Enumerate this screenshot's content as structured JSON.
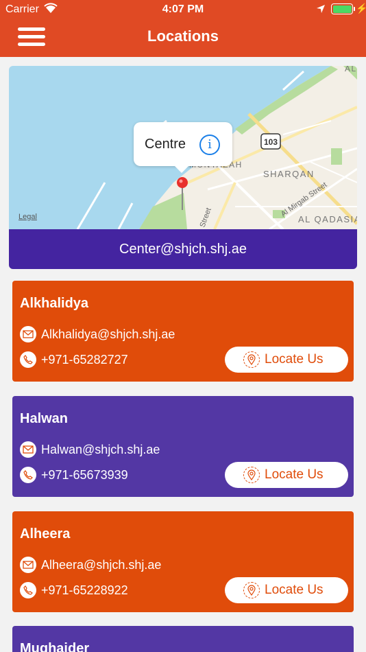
{
  "status_bar": {
    "carrier": "Carrier",
    "time": "4:07 PM"
  },
  "header": {
    "title": "Locations"
  },
  "map": {
    "callout_name": "Centre",
    "legal_label": "Legal",
    "labels": {
      "district_partial": "MUNTAZAH",
      "district2": "SHARQAN",
      "district3": "AL QADASIA",
      "street1": "Al Mirgab Street",
      "street2": "Street",
      "road_badge": "103",
      "corner": "AL"
    },
    "email": "Center@shjch.shj.ae"
  },
  "locations": [
    {
      "name": "Alkhalidya",
      "email": "Alkhalidya@shjch.shj.ae",
      "phone": "+971-65282727",
      "button": "Locate Us",
      "color": "orange"
    },
    {
      "name": "Halwan",
      "email": "Halwan@shjch.shj.ae",
      "phone": "+971-65673939",
      "button": "Locate Us",
      "color": "purple"
    },
    {
      "name": "Alheera",
      "email": "Alheera@shjch.shj.ae",
      "phone": "+971-65228922",
      "button": "Locate Us",
      "color": "orange"
    },
    {
      "name": "Mughaider",
      "color": "purple"
    }
  ],
  "colors": {
    "header": "#e04a24",
    "orange_card": "#e04c0a",
    "purple_card": "#5337a4",
    "map_email_bar": "#4424a0"
  }
}
